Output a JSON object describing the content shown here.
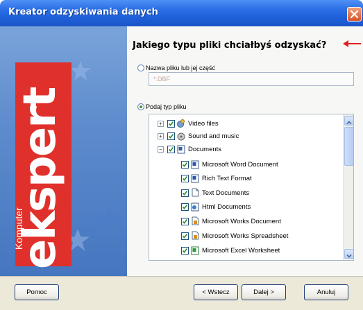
{
  "window": {
    "title": "Kreator odzyskiwania danych"
  },
  "sidebar": {
    "brand": "ekspert",
    "brand_small": "Komputer"
  },
  "main": {
    "heading": "Jakiego typu pliki chciałbyś odzyskać?",
    "option_name": {
      "label": "Nazwa pliku lub jej część",
      "selected": false
    },
    "name_field": {
      "value": "*.DBF",
      "placeholder": ""
    },
    "option_type": {
      "label": "Podaj typ pliku",
      "selected": true
    },
    "tree": [
      {
        "label": "Video files",
        "checked": true,
        "expander": "+",
        "icon": "video-icon"
      },
      {
        "label": "Sound and music",
        "checked": true,
        "expander": "+",
        "icon": "sound-icon"
      },
      {
        "label": "Documents",
        "checked": true,
        "expander": "−",
        "icon": "documents-icon"
      },
      {
        "label": "Microsoft Word Document",
        "checked": true,
        "icon": "word-doc-icon"
      },
      {
        "label": "Rich Text Format",
        "checked": true,
        "icon": "rtf-icon"
      },
      {
        "label": "Text Documents",
        "checked": true,
        "icon": "text-doc-icon"
      },
      {
        "label": "Html Documents",
        "checked": true,
        "icon": "html-doc-icon"
      },
      {
        "label": "Microsoft Works Document",
        "checked": true,
        "icon": "works-doc-icon"
      },
      {
        "label": "Microsoft Works Spreadsheet",
        "checked": true,
        "icon": "works-sheet-icon"
      },
      {
        "label": "Microsoft Excel Worksheet",
        "checked": true,
        "icon": "excel-icon"
      }
    ]
  },
  "buttons": {
    "help": "Pomoc",
    "back": "< Wstecz",
    "next": "Dalej >",
    "cancel": "Anuluj"
  },
  "colors": {
    "titlebar": "#2c6fe6",
    "brand_red": "#e0302b",
    "panel_blue": "#5d8bcc",
    "arrow_red": "#e02020"
  }
}
